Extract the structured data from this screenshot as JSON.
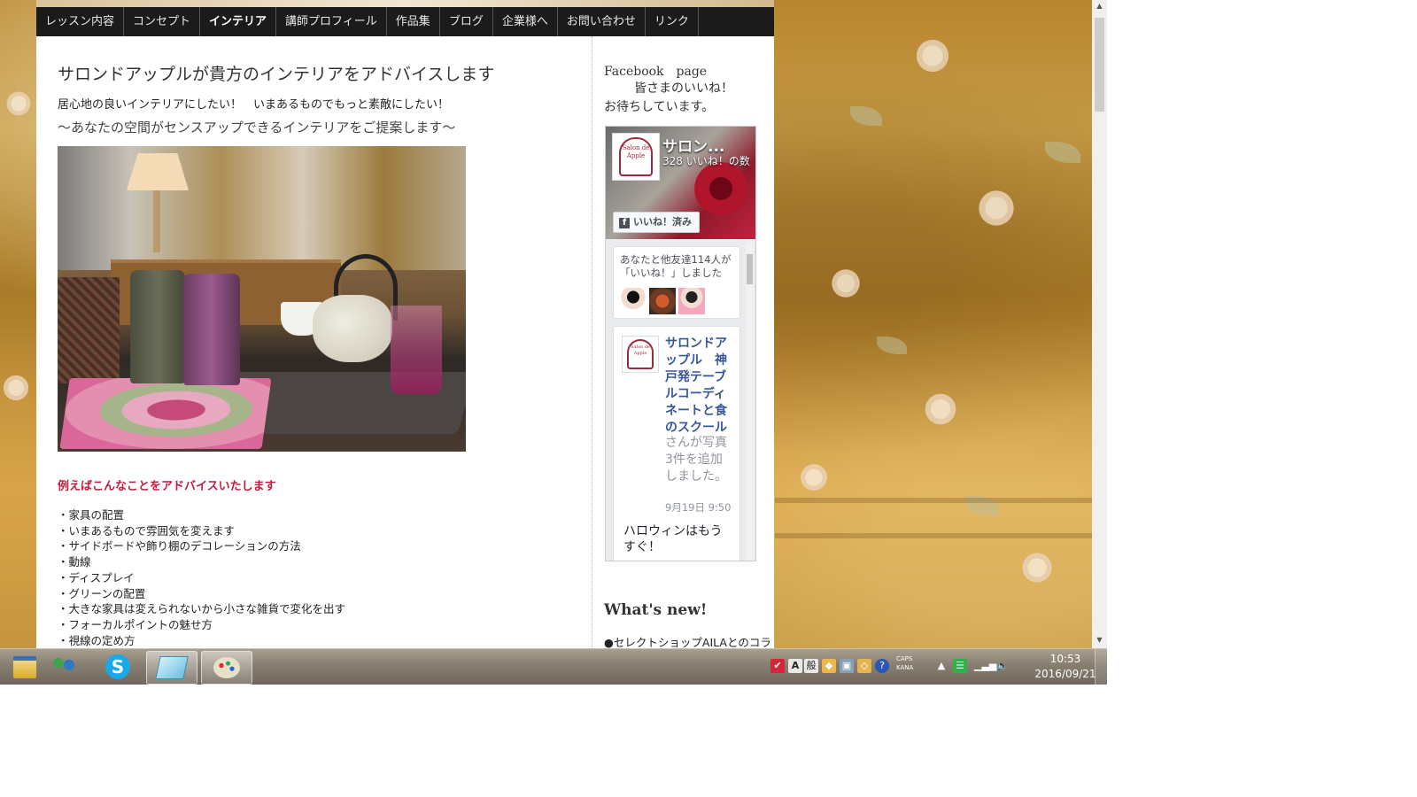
{
  "nav": {
    "items": [
      "レッスン内容",
      "コンセプト",
      "インテリア",
      "講師プロフィール",
      "作品集",
      "ブログ",
      "企業様へ",
      "お問い合わせ",
      "リンク"
    ],
    "active_index": 2
  },
  "main": {
    "title": "サロンドアップルが貴方のインテリアをアドバイスします",
    "intro": "居心地の良いインテリアにしたい！　いまあるものでもっと素敵にしたい！",
    "subtitle": "～あなたの空間がセンスアップできるインテリアをご提案します～",
    "advice_heading": "例えばこんなことをアドバイスいたします",
    "advice_items": [
      "・家具の配置",
      "・いまあるもので雰囲気を変えます",
      "・サイドボードや飾り棚のデコレーションの方法",
      "・動線",
      "・ディスプレイ",
      "・グリーンの配置",
      "・大きな家具は変えられないから小さな雑貨で変化を出す",
      "・フォーカルポイントの魅せ方",
      "・視線の定め方"
    ]
  },
  "sidebar": {
    "fb_title": "Facebook　page",
    "fb_text_line1": "皆さまのいいね！",
    "fb_text_line2": "お待ちしています。",
    "fb_widget": {
      "page_name": "サロン...",
      "likes": "328 いいね！の数",
      "like_button": "いいね！済み",
      "friends_text": "あなたと他友達114人が「いいね！」しました",
      "post_author": "サロンドアップル　神戸発テーブルコーディネートと食のスクール",
      "post_action": "さんが写真3件を追加しました。",
      "post_time": "9月19日 9:50",
      "post_body": "ハロウィンはもうすぐ！",
      "logo_text": "Salon de Apple"
    },
    "whatsnew_title": "What's new!",
    "whatsnew_item": "●セレクトショップAILAとのコラ"
  },
  "taskbar": {
    "tray_caps_line1": "CAPS",
    "tray_caps_line2": "KANA",
    "ime_label": "般",
    "time": "10:53",
    "date": "2016/09/21"
  },
  "colors": {
    "nav_bg": "#1b1b1b",
    "advice_heading": "#c11d3f",
    "fb_link": "#365899"
  }
}
